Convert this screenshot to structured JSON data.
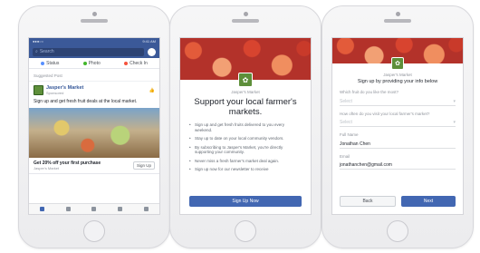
{
  "phone1": {
    "status_left": "●●●○○",
    "status_right": "9:41 AM",
    "search_placeholder": "Search",
    "actions": [
      {
        "label": "Status",
        "icon": "status-icon",
        "color": "#5890ff"
      },
      {
        "label": "Photo",
        "icon": "photo-icon",
        "color": "#42b72a"
      },
      {
        "label": "Check In",
        "icon": "checkin-icon",
        "color": "#f5533d"
      }
    ],
    "suggested_label": "Suggested Post",
    "post_author": "Jasper's Market",
    "post_sub": "Sponsored",
    "post_text": "Sign up and get fresh fruit deals at the local market.",
    "cta_title": "Get 20% off your first purchase",
    "cta_sub": "Jasper's Market",
    "cta_button": "Sign Up"
  },
  "phone2": {
    "brand": "Jasper's Market",
    "headline": "Support your local farmer's markets.",
    "bullets": [
      "Sign up and get fresh fruits delivered to you every weekend.",
      "Stay up to date on your local community vendors.",
      "By subscribing to Jasper's Market, you're directly supporting your community.",
      "Never miss a fresh farmer's market deal again.",
      "Sign up now for our newsletter to receive"
    ],
    "button": "Sign Up Now"
  },
  "phone3": {
    "brand": "Jasper's Market",
    "intro": "Sign up by providing your info below",
    "fields": [
      {
        "label": "Which fruit do you like the most?",
        "value": "Select",
        "placeholder": true
      },
      {
        "label": "How often do you visit your local farmer's market?",
        "value": "Select",
        "placeholder": true
      },
      {
        "label": "Full Name",
        "value": "Jonathan Chen",
        "placeholder": false
      },
      {
        "label": "Email",
        "value": "jonathanchen@gmail.com",
        "placeholder": false
      }
    ],
    "back_button": "Back",
    "next_button": "Next"
  },
  "colors": {
    "facebook_blue": "#3b5998",
    "button_blue": "#4267b2",
    "logo_green": "#5e8f3a"
  }
}
